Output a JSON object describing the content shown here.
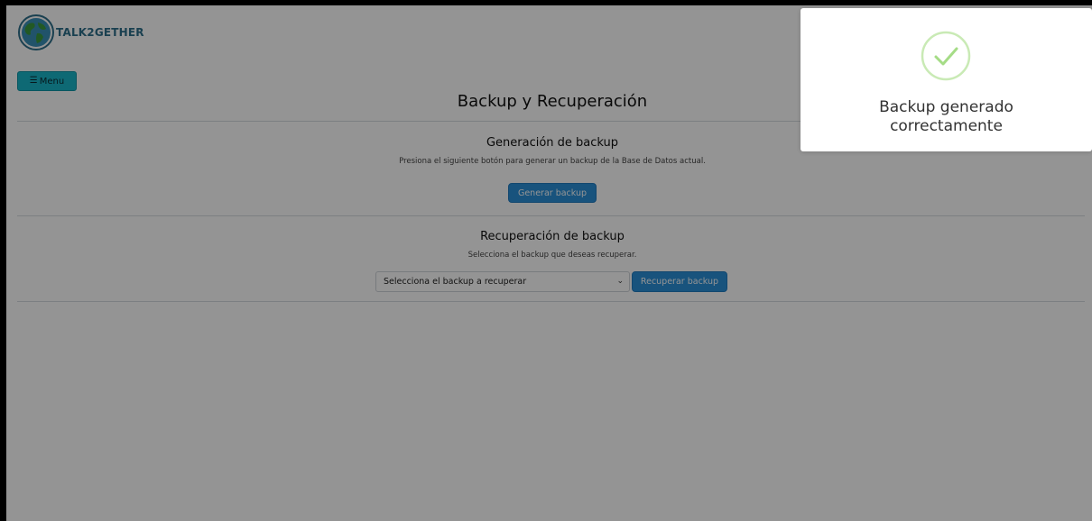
{
  "header": {
    "brand_name": "TALK2GETHER",
    "logo_icon": "globe-logo-icon",
    "menu_label": "Menu",
    "menu_icon": "hamburger-icon"
  },
  "main": {
    "title": "Backup y Recuperación",
    "generation": {
      "title": "Generación de backup",
      "description": "Presiona el siguiente botón para generar un backup de la Base de Datos actual.",
      "button_label": "Generar backup"
    },
    "recovery": {
      "title": "Recuperación de backup",
      "description": "Selecciona el backup que deseas recuperar.",
      "select_value": "Selecciona el backup a recuperar",
      "button_label": "Recuperar backup"
    }
  },
  "toast": {
    "icon": "success-check-icon",
    "message_line1": "Backup generado",
    "message_line2": "correctamente"
  },
  "colors": {
    "menu_button": "#19b6c8",
    "primary_button": "#2a8fd8",
    "brand_text": "#2d6e8a",
    "success": "#a5dc86"
  }
}
